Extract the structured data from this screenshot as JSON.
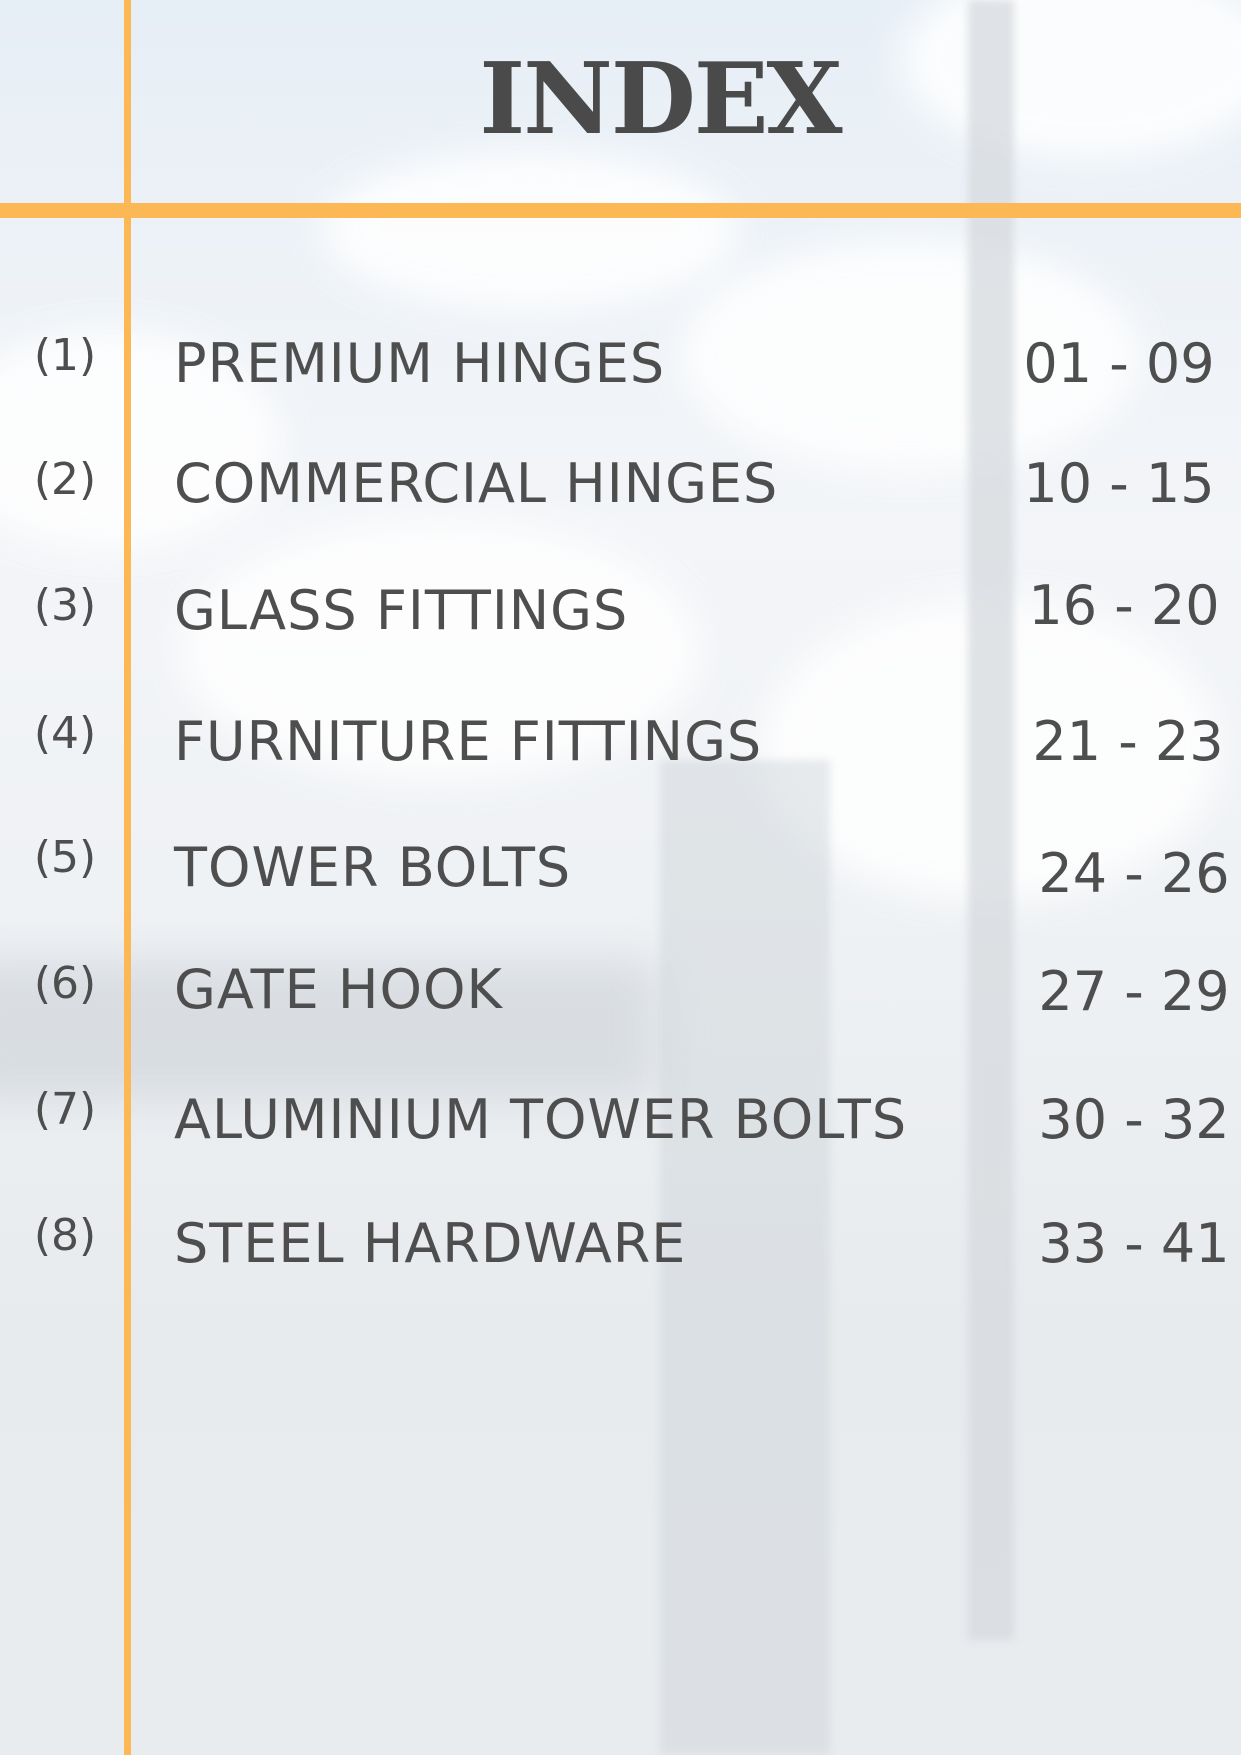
{
  "index": {
    "title": "INDEX",
    "entries": [
      {
        "number": "(1)",
        "label": "PREMIUM HINGES",
        "pages": "01 - 09"
      },
      {
        "number": "(2)",
        "label": "COMMERCIAL HINGES",
        "pages": "10 - 15"
      },
      {
        "number": "(3)",
        "label": "GLASS FITTINGS",
        "pages": "16 - 20"
      },
      {
        "number": "(4)",
        "label": "FURNITURE FITTINGS",
        "pages": "21 - 23"
      },
      {
        "number": "(5)",
        "label": "TOWER BOLTS",
        "pages": "24 - 26"
      },
      {
        "number": "(6)",
        "label": "GATE HOOK",
        "pages": "27 - 29"
      },
      {
        "number": "(7)",
        "label": "ALUMINIUM TOWER BOLTS",
        "pages": "30 - 32"
      },
      {
        "number": "(8)",
        "label": "STEEL HARDWARE",
        "pages": "33 - 41"
      }
    ]
  },
  "colors": {
    "accent_line": "#fbb854",
    "text": "#4a4a4a"
  }
}
